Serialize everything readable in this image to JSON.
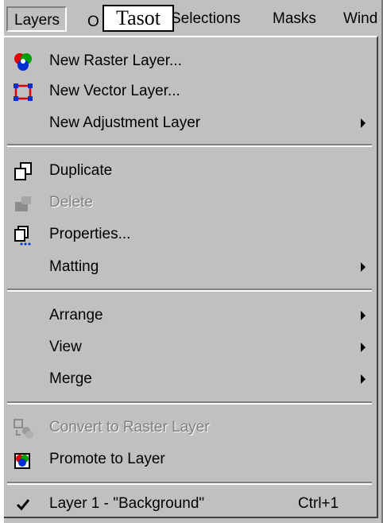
{
  "menubar": {
    "active": "Layers",
    "partial": "O",
    "items": [
      "Selections",
      "Masks",
      "Wind"
    ]
  },
  "tooltip": "Tasot",
  "menu": {
    "items": [
      {
        "label": "New Raster Layer...",
        "icon": "raster-layer-icon"
      },
      {
        "label": "New Vector Layer...",
        "icon": "vector-layer-icon"
      },
      {
        "label": "New Adjustment Layer",
        "submenu": true
      },
      {
        "label": "Duplicate",
        "icon": "duplicate-icon"
      },
      {
        "label": "Delete",
        "icon": "delete-icon",
        "disabled": true
      },
      {
        "label": "Properties...",
        "icon": "properties-icon"
      },
      {
        "label": "Matting",
        "submenu": true
      },
      {
        "label": "Arrange",
        "submenu": true
      },
      {
        "label": "View",
        "submenu": true
      },
      {
        "label": "Merge",
        "submenu": true
      },
      {
        "label": "Convert to Raster Layer",
        "icon": "convert-icon",
        "disabled": true
      },
      {
        "label": "Promote to Layer",
        "icon": "promote-icon"
      },
      {
        "label": "Layer 1 - \"Background\"",
        "checked": true,
        "shortcut": "Ctrl+1"
      }
    ]
  },
  "colors": {
    "face": "#c0c0c0",
    "shadow": "#808080",
    "highlight": "#ffffff",
    "text": "#000000",
    "disabled": "#808080"
  }
}
